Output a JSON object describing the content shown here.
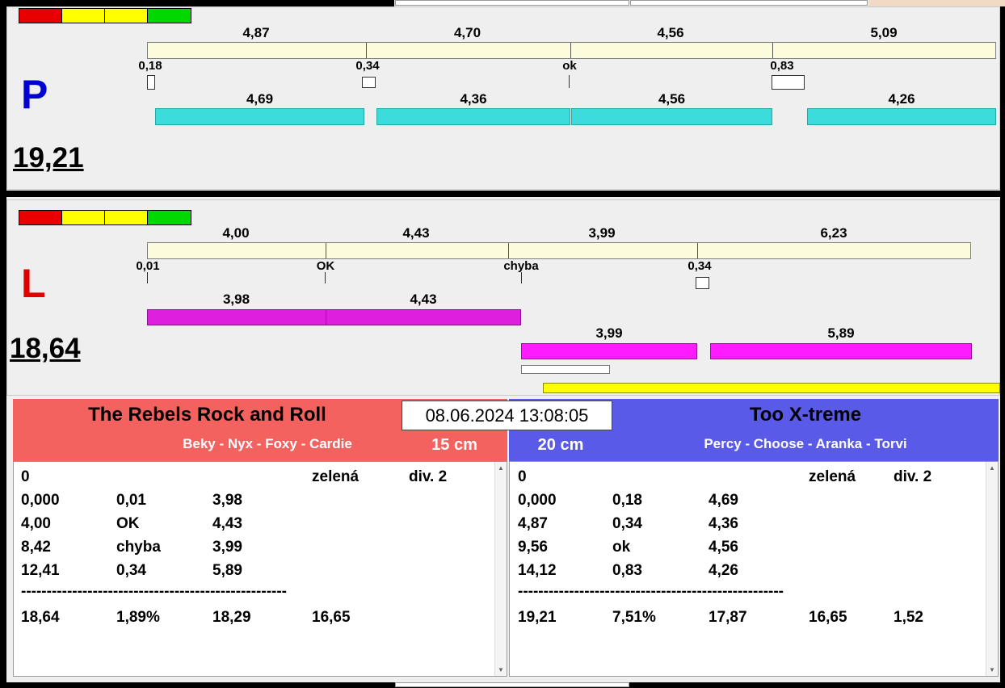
{
  "colors": {
    "cyan_bar": "#3CDCDC",
    "magenta_bar_row1": "#DE1FDE",
    "magenta_bar_row2": "#FF1BFF",
    "cream_bar": "#FCFCDC",
    "yellow_bar": "#FFFF00",
    "left_team_header": "#F4625F",
    "right_team_header": "#5A5AE8",
    "p_letter": "#0000D0",
    "l_letter": "#E00000",
    "status_lights": [
      "#E80000",
      "#FFFF00",
      "#FFFF00",
      "#00D800"
    ]
  },
  "p_panel": {
    "letter": "P",
    "total": "19,21",
    "top_splits": [
      "4,87",
      "4,70",
      "4,56",
      "5,09"
    ],
    "markers": [
      "0,18",
      "0,34",
      "ok",
      "0,83"
    ],
    "bottom_splits": [
      "4,69",
      "4,36",
      "4,56",
      "4,26"
    ]
  },
  "l_panel": {
    "letter": "L",
    "total": "18,64",
    "top_splits": [
      "4,00",
      "4,43",
      "3,99",
      "6,23"
    ],
    "markers": [
      "0,01",
      "OK",
      "chyba",
      "0,34"
    ],
    "bottom_splits_row1": [
      "3,98",
      "4,43"
    ],
    "bottom_splits_row2": [
      "3,99",
      "5,89"
    ]
  },
  "datetime": "08.06.2024 13:08:05",
  "left_team": {
    "name": "The Rebels Rock and Roll",
    "members": "Beky - Nyx - Foxy - Cardie",
    "category": "15 cm",
    "table": {
      "start": "0",
      "color": "zelená",
      "division": "div. 2",
      "rows": [
        [
          "0,000",
          "0,01",
          "3,98"
        ],
        [
          "4,00",
          "OK",
          "4,43"
        ],
        [
          "8,42",
          "chyba",
          "3,99"
        ],
        [
          "12,41",
          "0,34",
          "5,89"
        ]
      ],
      "divider": "----------------------------------------------------",
      "summary": [
        "18,64",
        "1,89%",
        "18,29",
        "16,65"
      ]
    }
  },
  "right_team": {
    "name": "Too X-treme",
    "members": "Percy - Choose - Aranka - Torvi",
    "category": "20 cm",
    "table": {
      "start": "0",
      "color": "zelená",
      "division": "div. 2",
      "rows": [
        [
          "0,000",
          "0,18",
          "4,69"
        ],
        [
          "4,87",
          "0,34",
          "4,36"
        ],
        [
          "9,56",
          "ok",
          "4,56"
        ],
        [
          "14,12",
          "0,83",
          "4,26"
        ]
      ],
      "divider": "----------------------------------------------------",
      "summary": [
        "19,21",
        "7,51%",
        "17,87",
        "16,65",
        "1,52"
      ]
    }
  },
  "scrollbar": {
    "up": "▲",
    "down": "▼"
  }
}
